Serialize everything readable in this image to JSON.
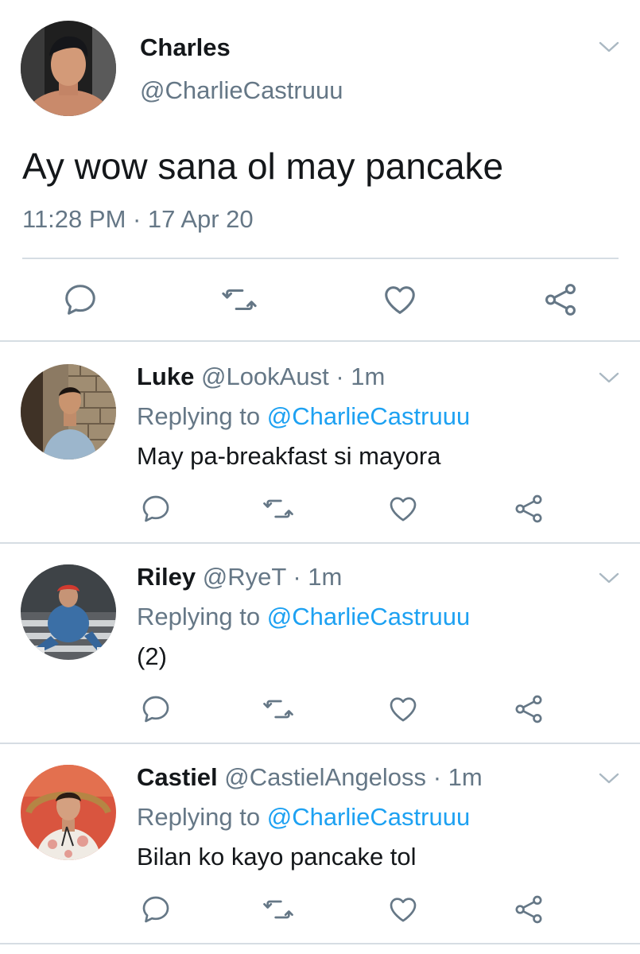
{
  "main_tweet": {
    "display_name": "Charles",
    "handle": "@CharlieCastruuu",
    "text": "Ay wow sana ol may pancake",
    "timestamp": "11:28 PM · 17 Apr 20"
  },
  "replies": [
    {
      "display_name": "Luke",
      "handle": "@LookAust",
      "time": "· 1m",
      "replying_label": "Replying to",
      "replying_to": "@CharlieCastruuu",
      "text": "May pa-breakfast si mayora"
    },
    {
      "display_name": "Riley",
      "handle": "@RyeT",
      "time": "· 1m",
      "replying_label": "Replying to",
      "replying_to": "@CharlieCastruuu",
      "text": "(2)"
    },
    {
      "display_name": "Castiel",
      "handle": "@CastielAngeloss",
      "time": "· 1m",
      "replying_label": "Replying to",
      "replying_to": "@CharlieCastruuu",
      "text": "Bilan ko kayo pancake tol"
    }
  ],
  "icons": {
    "reply": "speech-bubble",
    "retweet": "retweet-arrows",
    "like": "heart-outline",
    "share": "share-nodes",
    "more": "chevron-down"
  },
  "colors": {
    "text": "#14171a",
    "muted": "#657786",
    "link": "#1da1f2",
    "divider": "#d6dde3"
  }
}
